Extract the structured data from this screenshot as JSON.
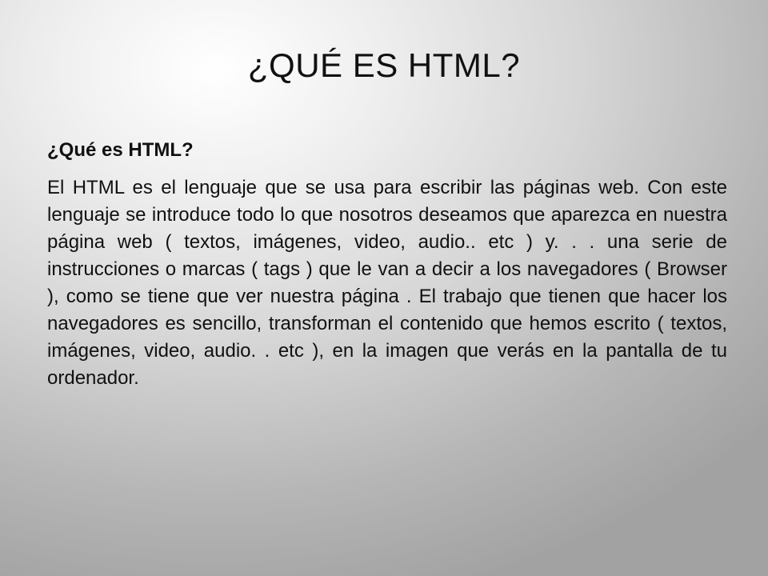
{
  "slide": {
    "title": "¿QUÉ ES HTML?",
    "subheading": "¿Qué es HTML?",
    "body": "El HTML es el lenguaje que se usa para escribir las páginas web. Con este lenguaje se introduce todo lo que nosotros deseamos que aparezca en nuestra página web ( textos, imágenes, video, audio.. etc ) y. . . una serie de instrucciones o marcas ( tags ) que le van a decir a los navegadores ( Browser ), como se tiene que ver nuestra página . El trabajo que tienen que hacer los navegadores es sencillo, transforman el contenido que hemos escrito ( textos, imágenes, video, audio. . etc ), en la imagen que verás en la pantalla de tu ordenador.",
    "background_colors": [
      "#ffffff",
      "#d6d6d6",
      "#a2a2a2"
    ]
  }
}
